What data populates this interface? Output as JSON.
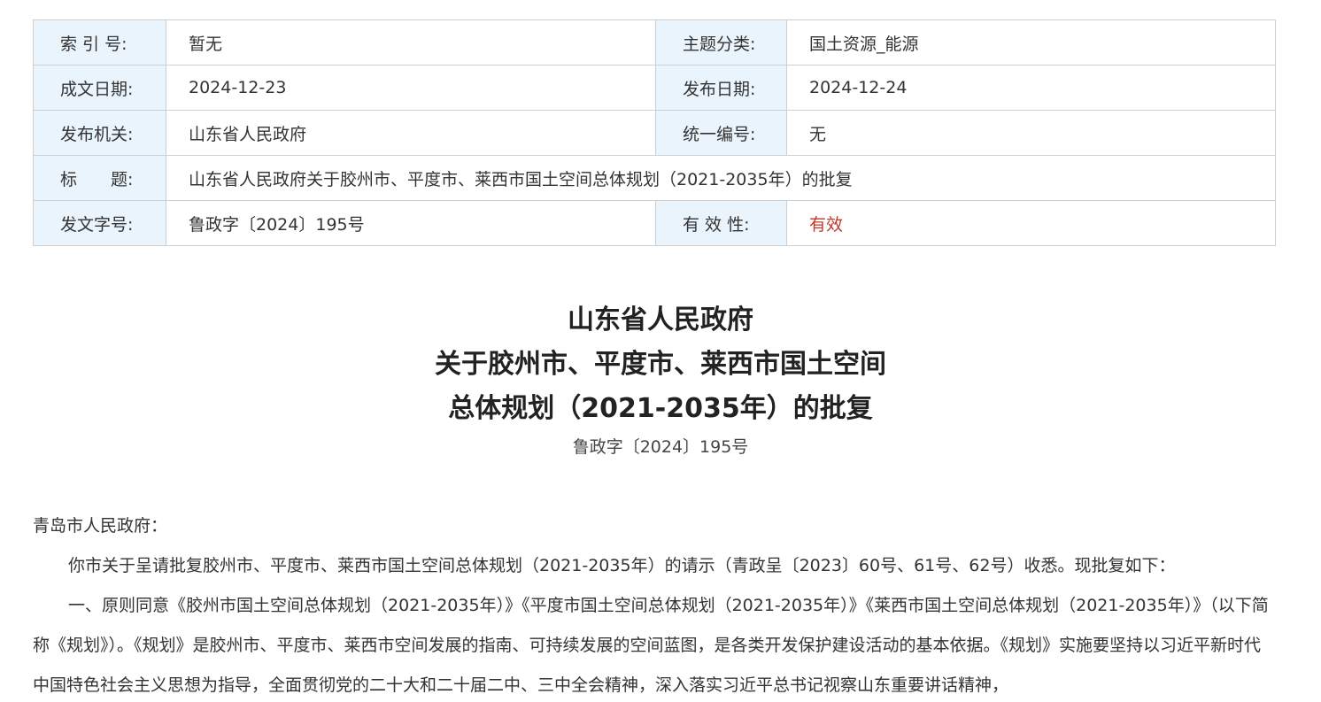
{
  "meta": {
    "rows": [
      {
        "l1": "索 引 号:",
        "v1": "暂无",
        "l2": "主题分类:",
        "v2": "国土资源_能源"
      },
      {
        "l1": "成文日期:",
        "v1": "2024-12-23",
        "l2": "发布日期:",
        "v2": "2024-12-24"
      },
      {
        "l1": "发布机关:",
        "v1": "山东省人民政府",
        "l2": "统一编号:",
        "v2": "无"
      },
      {
        "l1": "标　　题:",
        "v1": "山东省人民政府关于胶州市、平度市、莱西市国土空间总体规划（2021-2035年）的批复"
      },
      {
        "l1": "发文字号:",
        "v1": "鲁政字〔2024〕195号",
        "l2": "有 效 性:",
        "v2": "有效"
      }
    ],
    "valid_color": "#c0392b",
    "label_bg": "#eaf4fc"
  },
  "document": {
    "title_line1": "山东省人民政府",
    "title_line2": "关于胶州市、平度市、莱西市国土空间",
    "title_line3": "总体规划（2021-2035年）的批复",
    "number": "鲁政字〔2024〕195号",
    "salutation": "青岛市人民政府：",
    "paragraph1": "你市关于呈请批复胶州市、平度市、莱西市国土空间总体规划（2021-2035年）的请示（青政呈〔2023〕60号、61号、62号）收悉。现批复如下：",
    "paragraph2": "一、原则同意《胶州市国土空间总体规划（2021-2035年）》《平度市国土空间总体规划（2021-2035年）》《莱西市国土空间总体规划（2021-2035年）》（以下简称《规划》）。《规划》是胶州市、平度市、莱西市空间发展的指南、可持续发展的空间蓝图，是各类开发保护建设活动的基本依据。《规划》实施要坚持以习近平新时代中国特色社会主义思想为指导，全面贯彻党的二十大和二十届二中、三中全会精神，深入落实习近平总书记视察山东重要讲话精神，"
  }
}
